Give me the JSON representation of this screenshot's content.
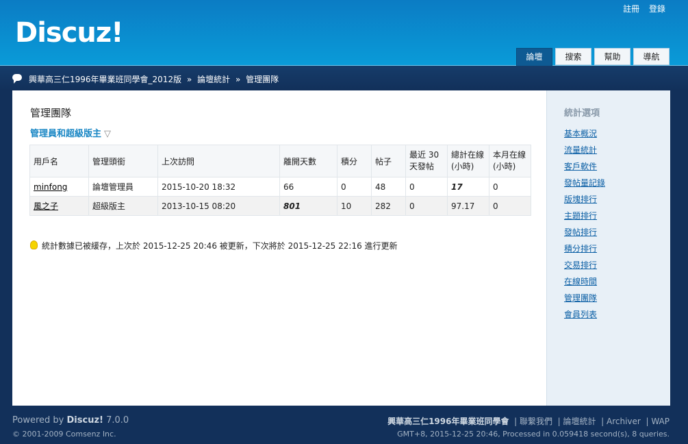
{
  "header": {
    "logo": "Discuz!",
    "toplinks": [
      "註冊",
      "登錄"
    ],
    "tabs": [
      "論壇",
      "搜索",
      "幫助",
      "導航"
    ]
  },
  "navbar": {
    "breadcrumb": [
      "興華高三仁1996年畢業班同學會_2012版",
      "論壇統計",
      "管理團隊"
    ],
    "separator": "»"
  },
  "main": {
    "title": "管理團隊",
    "section_title": "管理員和超級版主",
    "section_arrow": "▽",
    "table": {
      "headers": [
        "用戶名",
        "管理頭銜",
        "上次訪問",
        "離開天數",
        "積分",
        "帖子",
        "最近 30 天發帖",
        "總計在線 (小時)",
        "本月在線 (小時)"
      ],
      "rows": [
        [
          "minfong",
          "論壇管理員",
          "2015-10-20 18:32",
          "66",
          "0",
          "48",
          "0",
          "17",
          "0"
        ],
        [
          "風之子",
          "超級版主",
          "2013-10-15 08:20",
          "801",
          "10",
          "282",
          "0",
          "97.17",
          "0"
        ]
      ]
    },
    "notice": "統計數據已被緩存，上次於 2015-12-25 20:46 被更新，下次將於 2015-12-25 22:16 進行更新"
  },
  "sidebar": {
    "title": "統計選項",
    "items": [
      "基本概況",
      "流量統計",
      "客戶軟件",
      "發帖量記錄",
      "版塊排行",
      "主題排行",
      "發帖排行",
      "積分排行",
      "交易排行",
      "在線時間",
      "管理團隊",
      "會員列表"
    ]
  },
  "footer": {
    "powered_prefix": "Powered by",
    "powered_brand": "Discuz!",
    "powered_version": "7.0.0",
    "copyright": "© 2001-2009 Comsenz Inc.",
    "site_name": "興華高三仁1996年畢業班同學會",
    "links": [
      "聯繫我們",
      "論壇統計",
      "Archiver",
      "WAP"
    ],
    "gmt": "GMT+8, 2015-12-25 20:46, Processed in 0.059418 second(s), 8 queries."
  }
}
